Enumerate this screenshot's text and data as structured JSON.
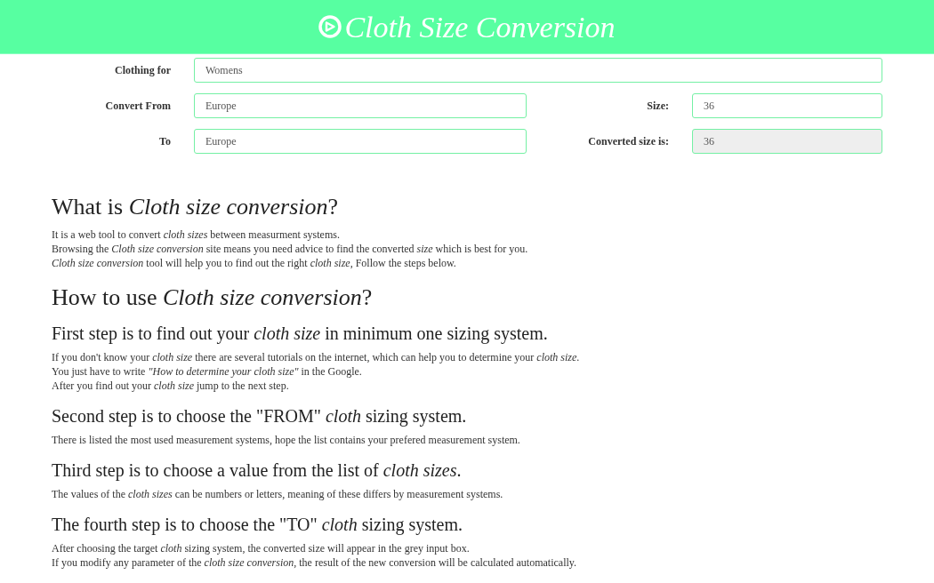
{
  "header": {
    "title": "Cloth Size Conversion"
  },
  "form": {
    "clothing_for": {
      "label": "Clothing for",
      "value": "Womens"
    },
    "convert_from": {
      "label": "Convert From",
      "value": "Europe"
    },
    "size": {
      "label": "Size:",
      "value": "36"
    },
    "to": {
      "label": "To",
      "value": "Europe"
    },
    "converted_size": {
      "label": "Converted size is:",
      "value": "36",
      "disabled": true
    }
  },
  "sections": [
    {
      "kind": "h2",
      "text": "What is *Cloth size conversion*?"
    },
    {
      "kind": "paragraph",
      "lines": [
        "It is a web tool to convert *cloth sizes* between measurment systems.",
        "Browsing the *Cloth size conversion* site means you need advice to find the converted *size* which is best for you.",
        "*Cloth size conversion* tool will help you to find out the right *cloth size*, Follow the steps below."
      ]
    },
    {
      "kind": "h2",
      "text": "How to use *Cloth size conversion*?"
    },
    {
      "kind": "h3",
      "text": "First step is to find out your *cloth size* in minimum one sizing system."
    },
    {
      "kind": "paragraph",
      "lines": [
        "If you don't know your *cloth size* there are several tutorials on the internet, which can help you to determine your *cloth size*.",
        "You just have to write *\"How to determine your cloth size\"* in the Google.",
        "After you find out your *cloth size* jump to the next step."
      ]
    },
    {
      "kind": "h3",
      "text": "Second step is to choose the \"FROM\" *cloth* sizing system."
    },
    {
      "kind": "paragraph",
      "lines": [
        "There is listed the most used measurement systems, hope the list contains your prefered measurement system."
      ]
    },
    {
      "kind": "h3",
      "text": "Third step is to choose a value from the list of *cloth sizes*."
    },
    {
      "kind": "paragraph",
      "lines": [
        "The values of the *cloth sizes* can be numbers or letters, meaning of these differs by measurement systems."
      ]
    },
    {
      "kind": "h3",
      "text": "The fourth step is to choose the \"TO\" *cloth* sizing system."
    },
    {
      "kind": "paragraph",
      "lines": [
        "After choosing the target *cloth* sizing system, the converted size will appear in the grey input box.",
        "If you modify any parameter of the *cloth size conversion*, the result of the new conversion will be calculated automatically."
      ]
    }
  ]
}
